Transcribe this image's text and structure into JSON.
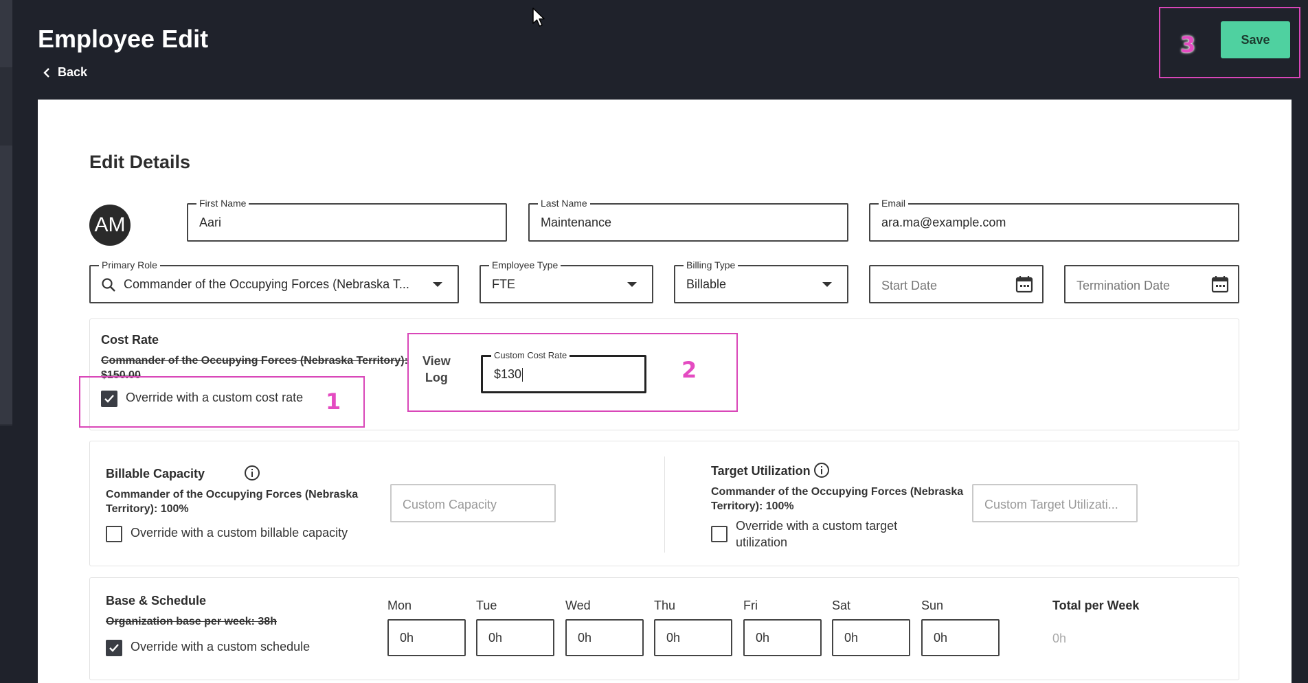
{
  "header": {
    "title": "Employee Edit",
    "back_label": "Back",
    "save_label": "Save"
  },
  "annotations": {
    "one": "1",
    "two": "2",
    "three": "3",
    "color": "#d946b8"
  },
  "colors": {
    "background": "#1f222b",
    "save_button": "#4fd1a0",
    "annotation": "#d946b8"
  },
  "edit_details": {
    "title": "Edit Details",
    "avatar_initials": "AM",
    "first_name": {
      "label": "First Name",
      "value": "Aari"
    },
    "last_name": {
      "label": "Last Name",
      "value": "Maintenance"
    },
    "email": {
      "label": "Email",
      "value": "ara.ma@example.com"
    },
    "primary_role": {
      "label": "Primary Role",
      "value": "Commander of the Occupying Forces (Nebraska T..."
    },
    "employee_type": {
      "label": "Employee Type",
      "value": "FTE"
    },
    "billing_type": {
      "label": "Billing Type",
      "value": "Billable"
    },
    "start_date": {
      "placeholder": "Start Date"
    },
    "termination_date": {
      "placeholder": "Termination Date"
    }
  },
  "cost_rate": {
    "title": "Cost Rate",
    "default_rate_line1": "Commander of the Occupying Forces (Nebraska Territory):",
    "default_rate_line2": "$150.00",
    "override_label": "Override with a custom cost rate",
    "override_checked": true,
    "view_log_line1": "View",
    "view_log_line2": "Log",
    "custom_rate": {
      "label": "Custom Cost Rate",
      "value": "$130"
    }
  },
  "billable_capacity": {
    "title": "Billable Capacity",
    "default_line1": "Commander of the Occupying Forces (Nebraska",
    "default_line2": "Territory): 100%",
    "override_label": "Override with a custom billable capacity",
    "override_checked": false,
    "custom_placeholder": "Custom Capacity"
  },
  "target_utilization": {
    "title": "Target Utilization",
    "default_line1": "Commander of the Occupying Forces (Nebraska",
    "default_line2": "Territory): 100%",
    "override_line1": "Override with a custom target",
    "override_line2": "utilization",
    "override_checked": false,
    "custom_placeholder": "Custom Target Utilizati..."
  },
  "schedule": {
    "title": "Base & Schedule",
    "org_base": "Organization base per week: 38h",
    "override_label": "Override with a custom schedule",
    "override_checked": true,
    "days": [
      {
        "label": "Mon",
        "value": "0h"
      },
      {
        "label": "Tue",
        "value": "0h"
      },
      {
        "label": "Wed",
        "value": "0h"
      },
      {
        "label": "Thu",
        "value": "0h"
      },
      {
        "label": "Fri",
        "value": "0h"
      },
      {
        "label": "Sat",
        "value": "0h"
      },
      {
        "label": "Sun",
        "value": "0h"
      }
    ],
    "total_label": "Total per Week",
    "total_value": "0h"
  }
}
